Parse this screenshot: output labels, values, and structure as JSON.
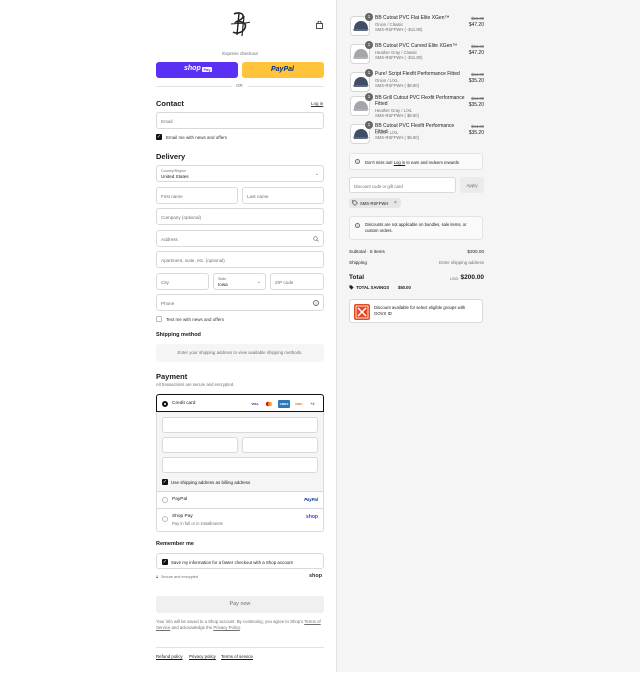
{
  "checkout": {
    "express_label": "Express checkout",
    "shop_pay_label": "shop",
    "shop_pay_badge": "Pay",
    "paypal_label": "PayPal",
    "or_label": "OR",
    "contact": {
      "title": "Contact",
      "login_label": "Log in",
      "email_placeholder": "Email",
      "email_news_label": "Email me with news and offers"
    },
    "delivery": {
      "title": "Delivery",
      "country_label": "Country/Region",
      "country_value": "United States",
      "first_name_placeholder": "First name",
      "last_name_placeholder": "Last name",
      "company_placeholder": "Company (optional)",
      "address_placeholder": "Address",
      "apartment_placeholder": "Apartment, suite, etc. (optional)",
      "city_placeholder": "City",
      "state_label": "State",
      "state_value": "Iowa",
      "zip_placeholder": "ZIP code",
      "phone_placeholder": "Phone",
      "text_news_label": "Text me with news and offers"
    },
    "shipping": {
      "title": "Shipping method",
      "info": "Enter your shipping address to view available shipping methods."
    },
    "payment": {
      "title": "Payment",
      "subtitle": "All transactions are secure and encrypted.",
      "credit_card_label": "Credit card",
      "card_brands": [
        "VISA",
        "MC",
        "AMEX",
        "DISC"
      ],
      "more_cards": "+4",
      "billing_same_label": "Use shipping address as billing address",
      "paypal_label": "PayPal",
      "paypal_logo": "PayPal",
      "shop_pay_label": "Shop Pay",
      "shop_pay_sub": "Pay in full or in installments",
      "shop_pay_logo": "shop"
    },
    "remember": {
      "title": "Remember me",
      "save_label": "Save my information for a faster checkout with a Shop account",
      "secure_label": "Secure and encrypted",
      "shop_logo": "shop"
    },
    "pay_now_label": "Pay now",
    "legal_1": "Your info will be saved to a Shop account. By continuing, you agree to Shop's",
    "legal_terms": "Terms of Service",
    "legal_and": "and acknowledge the",
    "legal_privacy": "Privacy Policy",
    "footer": [
      "Refund policy",
      "Privacy policy",
      "Terms of service"
    ]
  },
  "summary": {
    "items": [
      {
        "qty": "1",
        "name": "BB Cutout PVC Flat Elite XGen™",
        "variant": "Onion / Classic",
        "discount": "SMS-RSFFWH ( -$11.80)",
        "old_price": "$59.00",
        "price": "$47.20",
        "cap_color": "#3f4e66"
      },
      {
        "qty": "1",
        "name": "BB Cutout PVC Curved Elite XGen™",
        "variant": "Heather Gray / Classic",
        "discount": "SMS-RSFFWH ( -$11.80)",
        "old_price": "$59.00",
        "price": "$47.20",
        "cap_color": "#a3a5a8"
      },
      {
        "qty": "1",
        "name": "Pure! Script Flexfit Performance Fitted",
        "variant": "Onion / L/XL",
        "discount": "SMS-RSFFWH ( $8.80)",
        "old_price": "$44.00",
        "price": "$35.20",
        "cap_color": "#3f4e66"
      },
      {
        "qty": "1",
        "name": "BB Grill Cutout PVC Flexfit Performance Fitted",
        "variant": "Heather Gray / L/XL",
        "discount": "SMS-RSFFWH ( $8.80)",
        "old_price": "$44.00",
        "price": "$35.20",
        "cap_color": "#a3a5a8"
      },
      {
        "qty": "1",
        "name": "BB Cutout PVC Flexfit Performance Fitted",
        "variant": "Onion / L/XL",
        "discount": "SMS-RSFFWH ( $8.80)",
        "old_price": "$44.00",
        "price": "$35.20",
        "cap_color": "#3f4e66"
      }
    ],
    "rewards_pre": "Don't miss out!",
    "rewards_link": "Log in",
    "rewards_post": "to earn and redeem rewards",
    "discount_placeholder": "Discount code or gift card",
    "apply_label": "Apply",
    "code_tag": "SMS-RSFFWH",
    "discount_note": "Discounts are not applicable on bundles, sale items, or custom orders.",
    "subtotal_label": "Subtotal · 5 items",
    "subtotal_value": "$200.00",
    "shipping_label": "Shipping",
    "shipping_value": "Enter shipping address",
    "total_label": "Total",
    "currency": "USD",
    "total_value": "$200.00",
    "savings_label": "TOTAL SAVINGS",
    "savings_value": "$50.00",
    "govx_text": "Discount available for select eligible groups with GOVX ID"
  },
  "colors": {
    "shop_pay": "#5a31f4",
    "paypal": "#ffc439",
    "govx": "#e24b26"
  }
}
